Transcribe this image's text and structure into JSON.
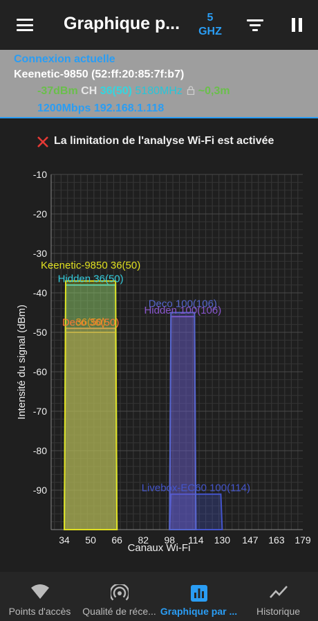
{
  "app_bar": {
    "title": "Graphique p...",
    "band_number": "5",
    "band_unit": "GHZ"
  },
  "connection": {
    "title": "Connexion actuelle",
    "ssid": "Keenetic-9850 (52:ff:20:85:7f:b7)",
    "signal": "-37dBm",
    "ch_label": "CH",
    "channel": "36(50)",
    "frequency": "5180MHz",
    "distance": "~0,3m",
    "speed_ip": "1200Mbps 192.168.1.118"
  },
  "warning": {
    "text": "La limitation de l'analyse Wi-Fi est activée"
  },
  "colors": {
    "accent": "#2a9df4",
    "signal_green": "#6abf4b",
    "channel_cyan": "#33d6e0",
    "frequency_teal": "#26c6da",
    "warning_red": "#e53935"
  },
  "chart_data": {
    "type": "area",
    "xlabel": "Canaux Wi-Fi",
    "ylabel": "Intensité du signal (dBm)",
    "ylim": [
      -100,
      -10
    ],
    "xlim": [
      26,
      179
    ],
    "y_ticks": [
      "-10",
      "-20",
      "-30",
      "-40",
      "-50",
      "-60",
      "-70",
      "-80",
      "-90"
    ],
    "x_ticks": [
      "34",
      "50",
      "66",
      "82",
      "98",
      "114",
      "130",
      "147",
      "163",
      "179"
    ],
    "grid": true,
    "series": [
      {
        "name": "Keenetic-9850 36(50)",
        "label": "Keenetic-9850 36(50)",
        "x_start": 34,
        "x_end": 66,
        "level": -37,
        "color": "#e0e020",
        "label_offset": -14
      },
      {
        "name": "Hidden 36(50)",
        "label": "Hidden 36(50)",
        "x_start": 34,
        "x_end": 66,
        "level": -38,
        "color": "#33ccdd",
        "label_offset": 0
      },
      {
        "name": "Deco 36(50)",
        "label": "Deco 36(50)",
        "x_start": 34,
        "x_end": 66,
        "level": -49,
        "color": "#ff7733",
        "label_offset": 0
      },
      {
        "name": "36(50)",
        "label": "36(50)",
        "x_start": 34,
        "x_end": 66,
        "level": -50,
        "color": "#dd9922",
        "label_offset": -6
      },
      {
        "name": "Deco 100(106)",
        "label": "Deco 100(106)",
        "x_start": 98,
        "x_end": 114,
        "level": -45,
        "color": "#5566cc",
        "label_offset": -4
      },
      {
        "name": "Hidden 100(106)",
        "label": "Hidden 100(106)",
        "x_start": 98,
        "x_end": 114,
        "level": -46,
        "color": "#8855cc",
        "label_offset": 0
      },
      {
        "name": "Livebox-EC60 100(114)",
        "label": "Livebox-EC60 100(114)",
        "x_start": 98,
        "x_end": 130,
        "level": -91,
        "color": "#4455cc",
        "label_offset": 0
      }
    ]
  },
  "bottom_nav": {
    "items": [
      {
        "label": "Points d'accès",
        "icon": "wifi-icon"
      },
      {
        "label": "Qualité de réce...",
        "icon": "signal-quality-icon"
      },
      {
        "label": "Graphique par ...",
        "icon": "bar-chart-icon"
      },
      {
        "label": "Historique",
        "icon": "trend-line-icon"
      }
    ]
  }
}
